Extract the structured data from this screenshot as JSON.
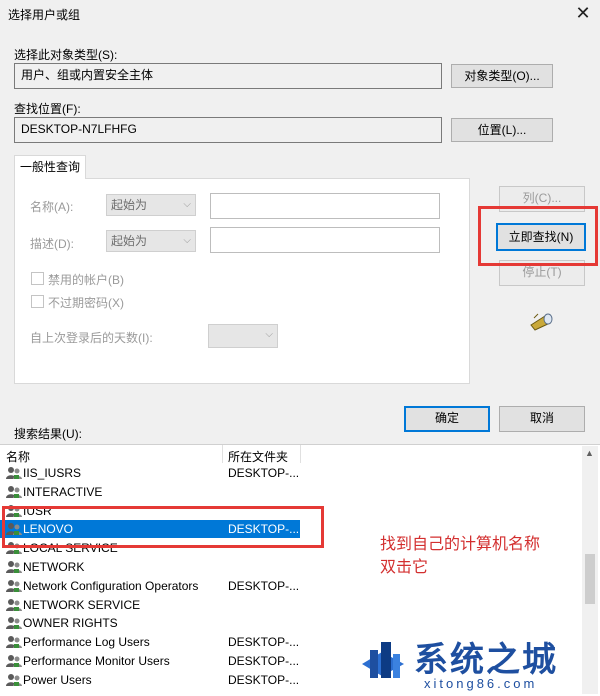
{
  "window": {
    "title": "选择用户或组"
  },
  "object_types": {
    "label": "选择此对象类型(S):",
    "value": "用户、组或内置安全主体",
    "button": "对象类型(O)..."
  },
  "location": {
    "label": "查找位置(F):",
    "value": "DESKTOP-N7LFHFG",
    "button": "位置(L)..."
  },
  "tab": {
    "label": "一般性查询"
  },
  "query": {
    "name_label": "名称(A):",
    "name_combo": "起始为",
    "desc_label": "描述(D):",
    "desc_combo": "起始为",
    "disabled_accounts": "禁用的帐户(B)",
    "non_expiring": "不过期密码(X)",
    "days_label": "自上次登录后的天数(I):"
  },
  "side_buttons": {
    "columns": "列(C)...",
    "find_now": "立即查找(N)",
    "stop": "停止(T)"
  },
  "dialog_buttons": {
    "ok": "确定",
    "cancel": "取消"
  },
  "results": {
    "label": "搜索结果(U):",
    "columns": [
      "名称",
      "所在文件夹"
    ],
    "rows": [
      {
        "name": "IIS_IUSRS",
        "folder": "DESKTOP-..."
      },
      {
        "name": "INTERACTIVE",
        "folder": ""
      },
      {
        "name": "IUSR",
        "folder": ""
      },
      {
        "name": "LENOVO",
        "folder": "DESKTOP-..."
      },
      {
        "name": "LOCAL SERVICE",
        "folder": ""
      },
      {
        "name": "NETWORK",
        "folder": ""
      },
      {
        "name": "Network Configuration Operators",
        "folder": "DESKTOP-..."
      },
      {
        "name": "NETWORK SERVICE",
        "folder": ""
      },
      {
        "name": "OWNER RIGHTS",
        "folder": ""
      },
      {
        "name": "Performance Log Users",
        "folder": "DESKTOP-..."
      },
      {
        "name": "Performance Monitor Users",
        "folder": "DESKTOP-..."
      },
      {
        "name": "Power Users",
        "folder": "DESKTOP-..."
      }
    ],
    "selected_index": 3
  },
  "annotation": {
    "line1": "找到自己的计算机名称",
    "line2": "双击它"
  },
  "watermark": {
    "brand": "系统之城",
    "url": "xitong86.com"
  },
  "colors": {
    "selection": "#0078d7",
    "annotation": "#e53935",
    "watermark": "#1e4fa0"
  }
}
